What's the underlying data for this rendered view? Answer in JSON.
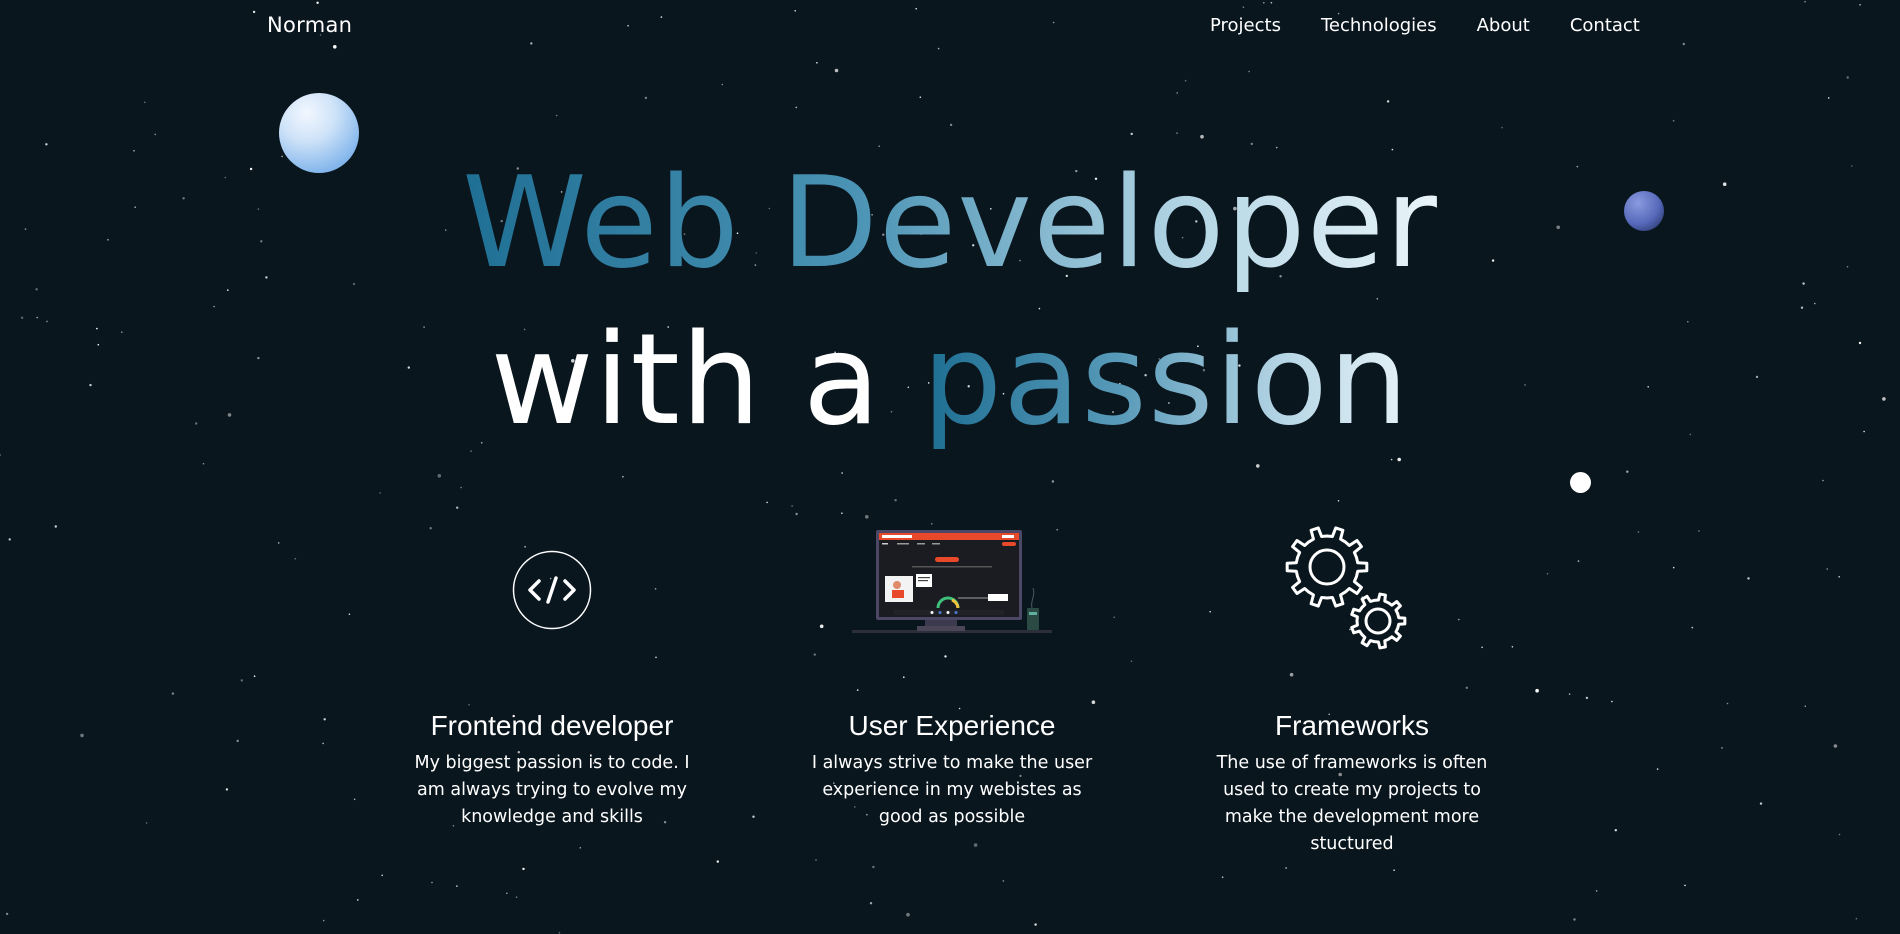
{
  "nav": {
    "brand": "Norman",
    "links": [
      "Projects",
      "Technologies",
      "About",
      "Contact"
    ]
  },
  "hero": {
    "line1_a": "Web Developer",
    "line2_a": "with a ",
    "line2_b": "passion"
  },
  "cards": [
    {
      "icon": "code-icon",
      "title": "Frontend developer",
      "text": "My biggest passion is to code. I am always trying to evolve my knowledge and skills"
    },
    {
      "icon": "monitor-illustration",
      "title": "User Experience",
      "text": "I always strive to make the user experience in my webistes as good as possible"
    },
    {
      "icon": "gears-icon",
      "title": "Frameworks",
      "text": "The use of frameworks is often used to create my projects to make the development more stuctured"
    }
  ],
  "colors": {
    "background": "#0a161e",
    "accent_dark": "#1f6f94",
    "accent_light": "#e9f4f9",
    "ui_red": "#e8492b"
  }
}
